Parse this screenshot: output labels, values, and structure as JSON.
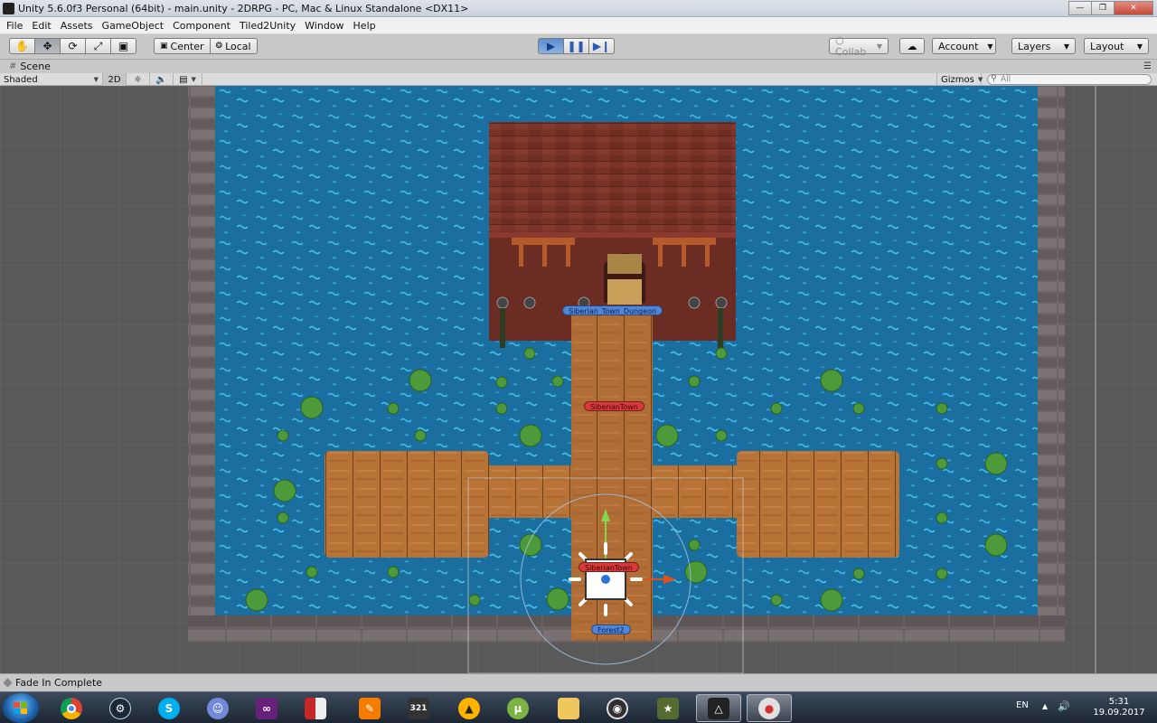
{
  "window": {
    "title": "Unity 5.6.0f3 Personal (64bit) - main.unity - 2DRPG - PC, Mac & Linux Standalone <DX11>"
  },
  "menu": [
    "File",
    "Edit",
    "Assets",
    "GameObject",
    "Component",
    "Tiled2Unity",
    "Window",
    "Help"
  ],
  "toolbar": {
    "transform_tools": [
      "hand-tool",
      "move-tool",
      "rotate-tool",
      "scale-tool",
      "rect-tool"
    ],
    "pivot": "Center",
    "space": "Local",
    "collab": "Collab",
    "account": "Account",
    "layers": "Layers",
    "layout": "Layout"
  },
  "scene": {
    "tab": "Scene",
    "shading": "Shaded",
    "mode_2d": "2D",
    "gizmos": "Gizmos",
    "search_placeholder": "All",
    "labels": {
      "dungeon": "Siberian_Town_Dungeon",
      "town_upper": "SiberianTown",
      "town_selected": "SiberianTown",
      "forest": "Forest2"
    }
  },
  "status": {
    "message": "Fade In Complete"
  },
  "taskbar": {
    "apps": [
      "chrome",
      "steam",
      "skype",
      "discord",
      "visual-studio",
      "app-window",
      "pdf-tool",
      "media-player-321",
      "aimp",
      "utorrent",
      "file-explorer",
      "obs",
      "game-app",
      "unity",
      "paint"
    ],
    "language": "EN",
    "time": "5:31",
    "date": "19.09.2017"
  },
  "colors": {
    "water": "#1a6fa0",
    "wood": "#b06d36",
    "roof": "#7a3328",
    "stone": "#6e6466",
    "label_blue": "#4f86d9",
    "label_red": "#d8393a",
    "play_active": "#5c8fd0"
  }
}
